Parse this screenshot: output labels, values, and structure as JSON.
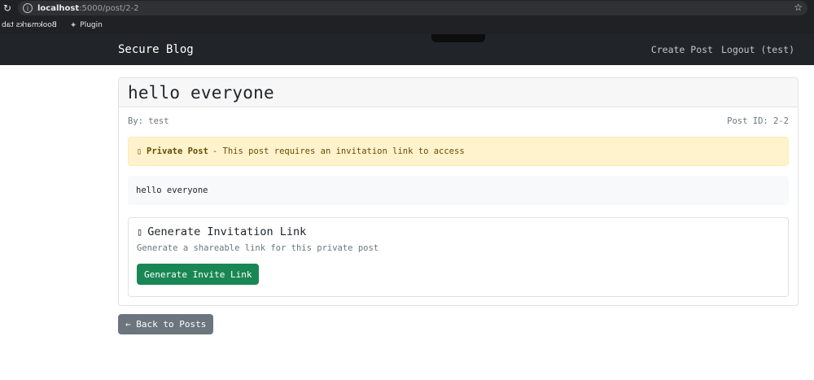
{
  "browser": {
    "url_host": "localhost",
    "url_path": ":5000/post/2-2",
    "bookmarks": [
      {
        "label": "Bookmarks tab"
      },
      {
        "label": "Plugin"
      }
    ]
  },
  "navbar": {
    "brand": "Secure Blog",
    "links": [
      "Create Post",
      "Logout (test)"
    ]
  },
  "post": {
    "title": "hello everyone",
    "author": "By: test",
    "post_id": "Post ID: 2-2",
    "private_label": "Private Post",
    "private_text": "- This post requires an invitation link to access",
    "content": "hello everyone"
  },
  "invite": {
    "title": "Generate Invitation Link",
    "subtitle": "Generate a shareable link for this private post",
    "button": "Generate Invite Link"
  },
  "back_button": "← Back to Posts",
  "icons": {
    "lock": "lock-icon",
    "link": "link-icon"
  },
  "colors": {
    "navbar": "#212529",
    "alert_bg": "#fff3cd",
    "success": "#198754",
    "secondary": "#6c757d"
  }
}
